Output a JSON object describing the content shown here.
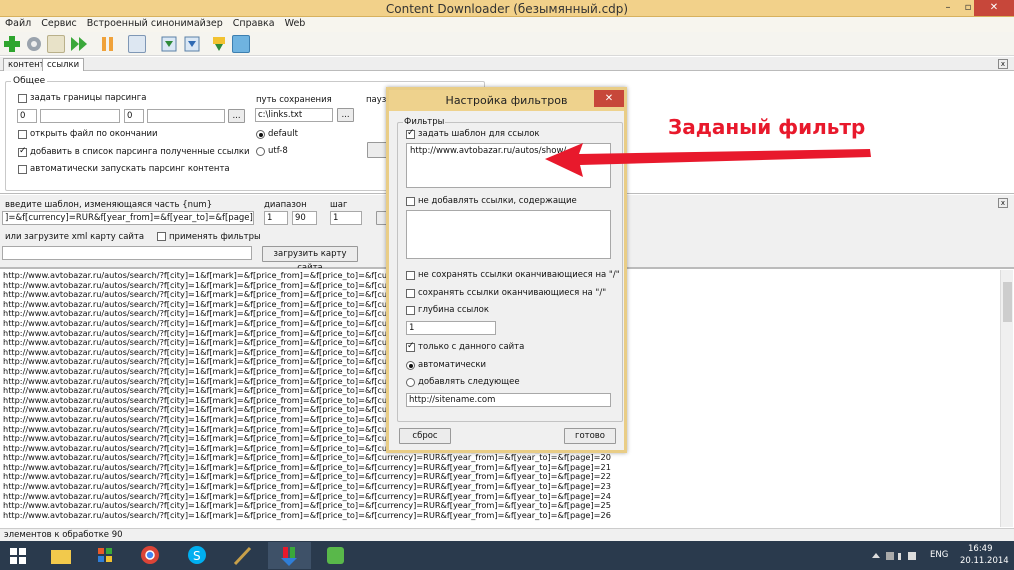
{
  "window": {
    "title": "Content Downloader (безымянный.cdp)",
    "minimize": "–",
    "maximize": "▫",
    "close": "✕"
  },
  "menu": [
    "Файл",
    "Сервис",
    "Встроенный синонимайзер",
    "Справка",
    "Web"
  ],
  "tabs": [
    {
      "label": "контент"
    },
    {
      "label": "ссылки"
    }
  ],
  "close_x": "x",
  "general": {
    "group_label": "Общее",
    "set_bounds": "задать границы парсинга",
    "bound_a": "0",
    "bound_b": "0",
    "browse": "...",
    "open_file_end": "открыть файл по окончании",
    "add_to_list": "добавить в список парсинга полученные ссылки",
    "auto_start": "автоматически запускать парсинг контента",
    "save_path_label": "путь сохранения",
    "save_path": "c:\\links.txt",
    "pause_label": "пауза",
    "enc_default": "default",
    "enc_utf8": "utf-8"
  },
  "template": {
    "label": "введите шаблон, изменяющаяся часть {num}",
    "value": "]=&f[currency]=RUR&f[year_from]=&f[year_to]=&f[page]={num}",
    "range_label": "диапазон",
    "range_from": "1",
    "range_to": "90",
    "step_label": "шаг",
    "step": "1",
    "xml_label": "или загрузите xml карту сайта",
    "apply_filters": "применять фильтры",
    "load_sitemap": "загрузить карту сайта"
  },
  "list": {
    "row_left": "http://www.avtobazar.ru/autos/search/?f[city]=1&f[mark]=&f[price_from]=&f[price_to]=&f[currency]=RU",
    "row_right_prefix": "R&f[year_from]=&f[year_to]=&f[page]=",
    "rows": [
      "http://www.avtobazar.ru/autos/search/?f[city]=1&f[mark]=&f[price_from]=&f[price_to]=&f[currency]=RU",
      "http://www.avtobazar.ru/autos/search/?f[city]=1&f[mark]=&f[price_from]=&f[price_to]=&f[currency]=RU",
      "http://www.avtobazar.ru/autos/search/?f[city]=1&f[mark]=&f[price_from]=&f[price_to]=&f[currency]=RU",
      "http://www.avtobazar.ru/autos/search/?f[city]=1&f[mark]=&f[price_from]=&f[price_to]=&f[currency]=RU",
      "http://www.avtobazar.ru/autos/search/?f[city]=1&f[mark]=&f[price_from]=&f[price_to]=&f[currency]=RU",
      "http://www.avtobazar.ru/autos/search/?f[city]=1&f[mark]=&f[price_from]=&f[price_to]=&f[currency]=RU",
      "http://www.avtobazar.ru/autos/search/?f[city]=1&f[mark]=&f[price_from]=&f[price_to]=&f[currency]=RU",
      "http://www.avtobazar.ru/autos/search/?f[city]=1&f[mark]=&f[price_from]=&f[price_to]=&f[currency]=RU",
      "http://www.avtobazar.ru/autos/search/?f[city]=1&f[mark]=&f[price_from]=&f[price_to]=&f[currency]=RU",
      "http://www.avtobazar.ru/autos/search/?f[city]=1&f[mark]=&f[price_from]=&f[price_to]=&f[currency]=RU",
      "http://www.avtobazar.ru/autos/search/?f[city]=1&f[mark]=&f[price_from]=&f[price_to]=&f[currency]=RU",
      "http://www.avtobazar.ru/autos/search/?f[city]=1&f[mark]=&f[price_from]=&f[price_to]=&f[currency]=RU",
      "http://www.avtobazar.ru/autos/search/?f[city]=1&f[mark]=&f[price_from]=&f[price_to]=&f[currency]=RU",
      "http://www.avtobazar.ru/autos/search/?f[city]=1&f[mark]=&f[price_from]=&f[price_to]=&f[currency]=RU",
      "http://www.avtobazar.ru/autos/search/?f[city]=1&f[mark]=&f[price_from]=&f[price_to]=&f[currency]=RU",
      "http://www.avtobazar.ru/autos/search/?f[city]=1&f[mark]=&f[price_from]=&f[price_to]=&f[currency]=RU",
      "http://www.avtobazar.ru/autos/search/?f[city]=1&f[mark]=&f[price_from]=&f[price_to]=&f[currency]=RU",
      "http://www.avtobazar.ru/autos/search/?f[city]=1&f[mark]=&f[price_from]=&f[price_to]=&f[currency]=RU",
      "http://www.avtobazar.ru/autos/search/?f[city]=1&f[mark]=&f[price_from]=&f[price_to]=&f[currency]=RUR&f[year_from]=&f[year_to]=&f[page]=19",
      "http://www.avtobazar.ru/autos/search/?f[city]=1&f[mark]=&f[price_from]=&f[price_to]=&f[currency]=RUR&f[year_from]=&f[year_to]=&f[page]=20",
      "http://www.avtobazar.ru/autos/search/?f[city]=1&f[mark]=&f[price_from]=&f[price_to]=&f[currency]=RUR&f[year_from]=&f[year_to]=&f[page]=21",
      "http://www.avtobazar.ru/autos/search/?f[city]=1&f[mark]=&f[price_from]=&f[price_to]=&f[currency]=RUR&f[year_from]=&f[year_to]=&f[page]=22",
      "http://www.avtobazar.ru/autos/search/?f[city]=1&f[mark]=&f[price_from]=&f[price_to]=&f[currency]=RUR&f[year_from]=&f[year_to]=&f[page]=23",
      "http://www.avtobazar.ru/autos/search/?f[city]=1&f[mark]=&f[price_from]=&f[price_to]=&f[currency]=RUR&f[year_from]=&f[year_to]=&f[page]=24",
      "http://www.avtobazar.ru/autos/search/?f[city]=1&f[mark]=&f[price_from]=&f[price_to]=&f[currency]=RUR&f[year_from]=&f[year_to]=&f[page]=25",
      "http://www.avtobazar.ru/autos/search/?f[city]=1&f[mark]=&f[price_from]=&f[price_to]=&f[currency]=RUR&f[year_from]=&f[year_to]=&f[page]=26"
    ]
  },
  "status": "элементов к обработке 90",
  "dialog": {
    "title": "Настройка фильтров",
    "close": "✕",
    "group_label": "Фильтры",
    "set_template": "задать шаблон для ссылок",
    "template_value": "http://www.avtobazar.ru/autos/show/",
    "no_add_containing": "не добавлять ссылки, содержащие",
    "no_save_ending": "не сохранять ссылки оканчивающиеся на  \"/\"",
    "save_ending": "сохранять ссылки оканчивающиеся на \"/\"",
    "depth": "глубина ссылок",
    "depth_value": "1",
    "only_site": "только с данного сайта",
    "auto": "автоматически",
    "add_next": "добавлять следующее",
    "site_value": "http://sitename.com",
    "reset": "сброс",
    "done": "готово"
  },
  "annotation": "Заданый фильтр",
  "taskbar": {
    "lang": "ENG",
    "time": "16:49",
    "date": "20.11.2014"
  },
  "colors": {
    "titlebar": "#f2d18a",
    "close": "#c7473a",
    "callout": "#e8192c",
    "taskbar": "#2a3a4d"
  }
}
